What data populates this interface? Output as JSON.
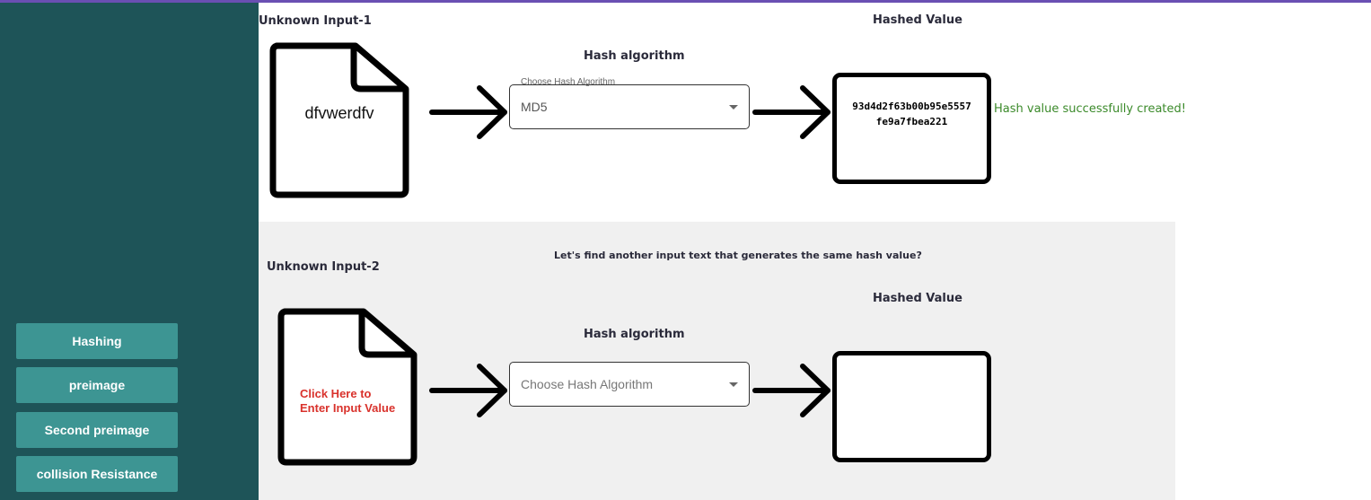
{
  "sidebar": {
    "items": [
      {
        "label": "Hashing"
      },
      {
        "label": "preimage"
      },
      {
        "label": "Second preimage"
      },
      {
        "label": "collision Resistance"
      }
    ]
  },
  "section1": {
    "input_title": "Unknown Input-1",
    "input_value": "dfvwerdfv",
    "algorithm_title": "Hash algorithm",
    "select_label": "Choose Hash Algorithm",
    "select_value": "MD5",
    "hashed_title": "Hashed Value",
    "hash_value": "93d4d2f63b00b95e5557fe9a7fbea221",
    "status": "Hash value successfully created!"
  },
  "section2": {
    "question": "Let's find another input text that generates the same hash value?",
    "input_title": "Unknown Input-2",
    "input_placeholder_line1": "Click Here to",
    "input_placeholder_line2": "Enter Input Value",
    "algorithm_title": "Hash algorithm",
    "select_placeholder": "Choose Hash Algorithm",
    "hashed_title": "Hashed Value",
    "hash_value": ""
  },
  "colors": {
    "sidebar_bg": "#1e5458",
    "nav_button": "#3d9593",
    "top_accent": "#6a4fb3",
    "success_text": "#3b8a2a",
    "placeholder_red": "#d9322c"
  }
}
